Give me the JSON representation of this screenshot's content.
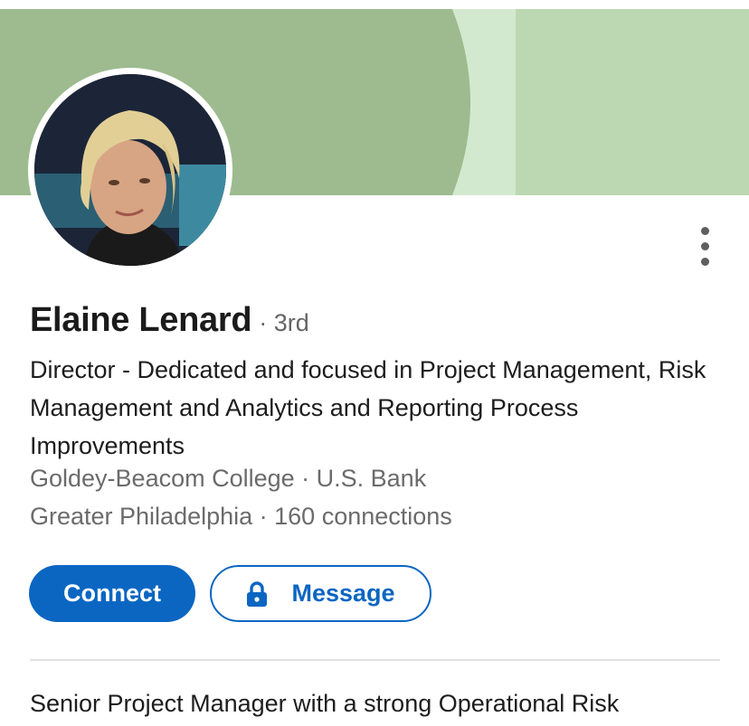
{
  "profile": {
    "name": "Elaine Lenard",
    "degree": "· 3rd",
    "headline": "Director - Dedicated and focused in Project Management, Risk Management and Analytics and Reporting Process Improvements",
    "education_company": "Goldey-Beacom College · U.S. Bank",
    "location_connections": "Greater Philadelphia · 160 connections",
    "about_preview": "Senior Project Manager with a strong Operational Risk"
  },
  "actions": {
    "connect_label": "Connect",
    "message_label": "Message"
  },
  "icons": {
    "more": "more-vertical-icon",
    "lock": "lock-icon"
  },
  "colors": {
    "accent": "#0b66c2",
    "banner_dark": "#9dbb8f",
    "banner_light": "#d3e9cf",
    "banner_mid": "#bcd8b2"
  }
}
